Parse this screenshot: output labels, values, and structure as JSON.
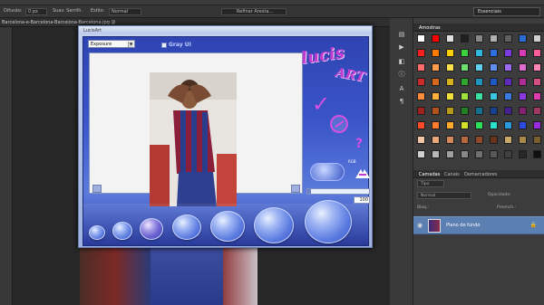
{
  "options_bar": {
    "feather_label": "Difusão:",
    "feather_value": "0 px",
    "antialias_label": "Suav. Serrilh.",
    "style_label": "Estilo:",
    "style_value": "Normal",
    "refine_label": "Refinar Aresta...",
    "workspace": "Essenciais"
  },
  "document_tab": "Barcelona-e-Barcelona-Barcelona-Barcelona.jpg @",
  "dialog": {
    "title": "LucisArt",
    "effect_select": "Exposure",
    "gray_label": "Gray UI",
    "brand_line1": "lucis",
    "brand_line2": "ART",
    "apply_label": "",
    "mode_label": "RGB",
    "slider_value": "100",
    "check_icon": "checkmark-icon",
    "cancel_icon": "cancel-icon",
    "help_icon": "help-icon"
  },
  "swatches_panel": {
    "tab": "Amostras"
  },
  "layers_panel": {
    "tabs": [
      "Camadas",
      "Canais",
      "Demarcadores"
    ],
    "kind_label": "Tipo",
    "blend_mode": "Normal",
    "opacity_label": "Opacidade:",
    "lock_label": "Bloq.:",
    "fill_label": "Preench.:",
    "layer_name": "Plano de fundo"
  },
  "colors": {
    "ps_dark": "#2b2b2b",
    "dialog_blue": "#3a55c8",
    "brand_magenta": "#c23bd0",
    "layer_selected": "#5b7fb0"
  }
}
